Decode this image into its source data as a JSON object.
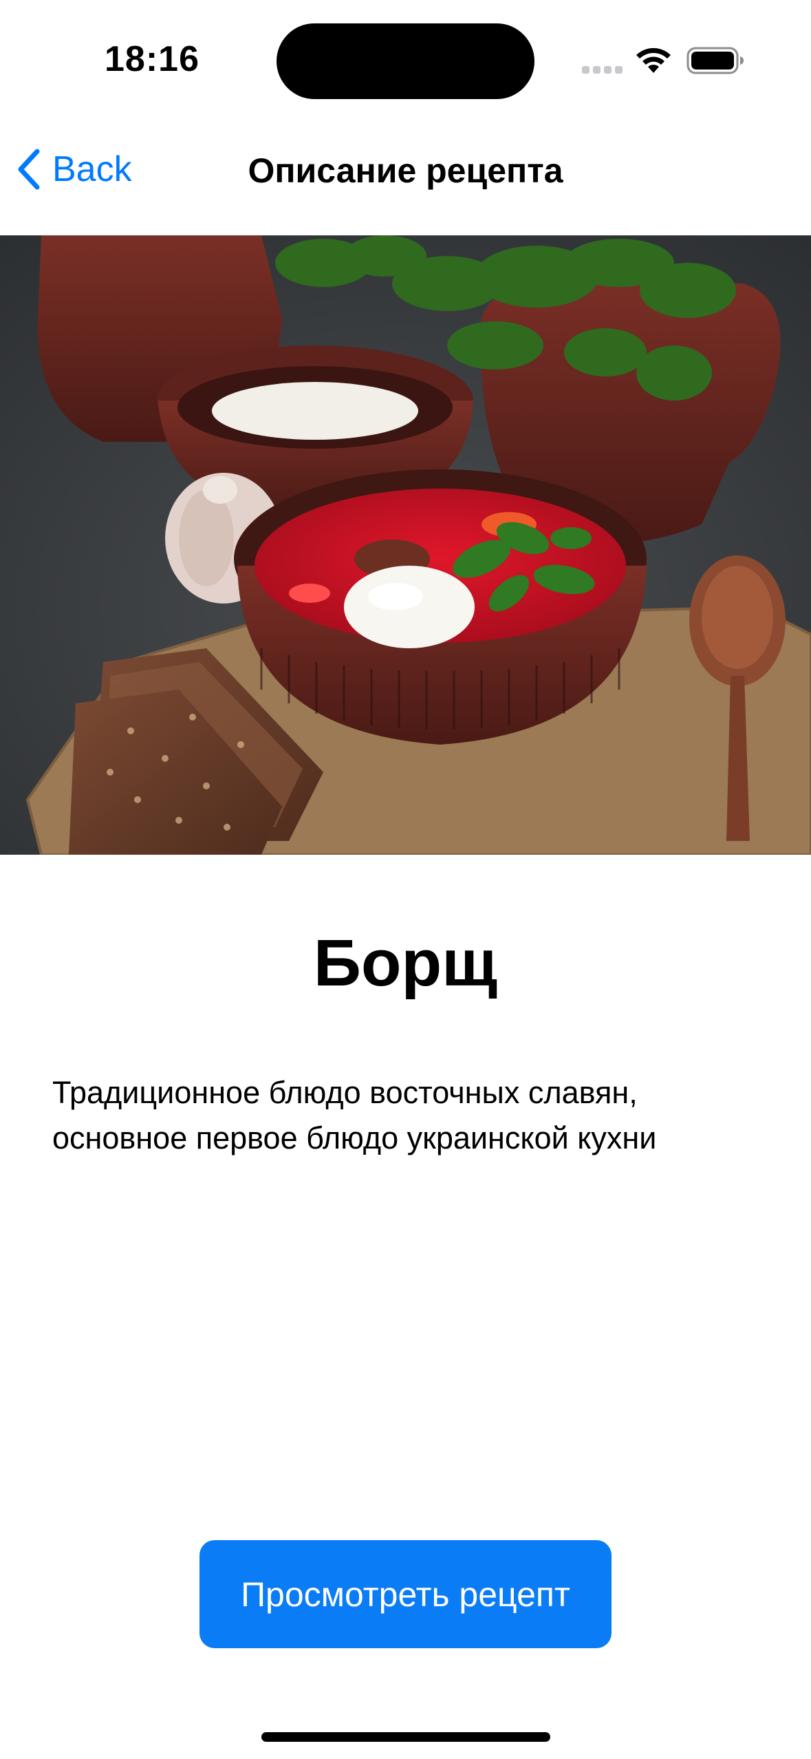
{
  "status_bar": {
    "time": "18:16"
  },
  "nav": {
    "back_label": "Back",
    "title": "Описание рецепта"
  },
  "hero_image": {
    "icon": "borscht-photo"
  },
  "recipe": {
    "title": "Борщ",
    "description": "Традиционное блюдо восточных славян, основное первое блюдо украинской кухни"
  },
  "action": {
    "view_recipe_label": "Просмотреть рецепт"
  },
  "colors": {
    "accent": "#007aff",
    "button": "#0a7cf5",
    "background": "#ffffff"
  }
}
